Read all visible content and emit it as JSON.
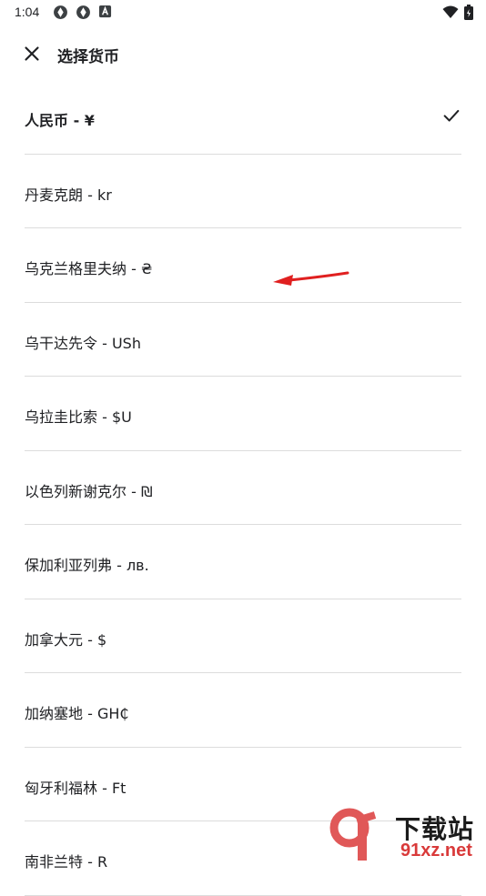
{
  "status_bar": {
    "time": "1:04",
    "left_icons": [
      "gear-like-icon",
      "gear-like-icon",
      "a-box-icon"
    ],
    "right_icons": [
      "wifi-icon",
      "battery-icon"
    ]
  },
  "app_bar": {
    "title": "选择货币",
    "close_icon": "close-icon"
  },
  "currencies": [
    {
      "label": "人民币 - ¥",
      "selected": true
    },
    {
      "label": "丹麦克朗 - kr",
      "selected": false
    },
    {
      "label": "乌克兰格里夫纳 - ₴",
      "selected": false
    },
    {
      "label": "乌干达先令 - USh",
      "selected": false
    },
    {
      "label": "乌拉圭比索 - $U",
      "selected": false
    },
    {
      "label": "以色列新谢克尔 - ₪",
      "selected": false
    },
    {
      "label": "保加利亚列弗 - лв.",
      "selected": false
    },
    {
      "label": "加拿大元 - $",
      "selected": false
    },
    {
      "label": "加纳塞地 - GH₵",
      "selected": false
    },
    {
      "label": "匈牙利福林 - Ft",
      "selected": false
    },
    {
      "label": "南非兰特 - R",
      "selected": false
    }
  ],
  "watermark": {
    "top": "下载站",
    "bottom": "91xz.net"
  },
  "colors": {
    "accent_arrow": "#e02020",
    "divider": "#dcdcdc",
    "text": "#202124"
  }
}
